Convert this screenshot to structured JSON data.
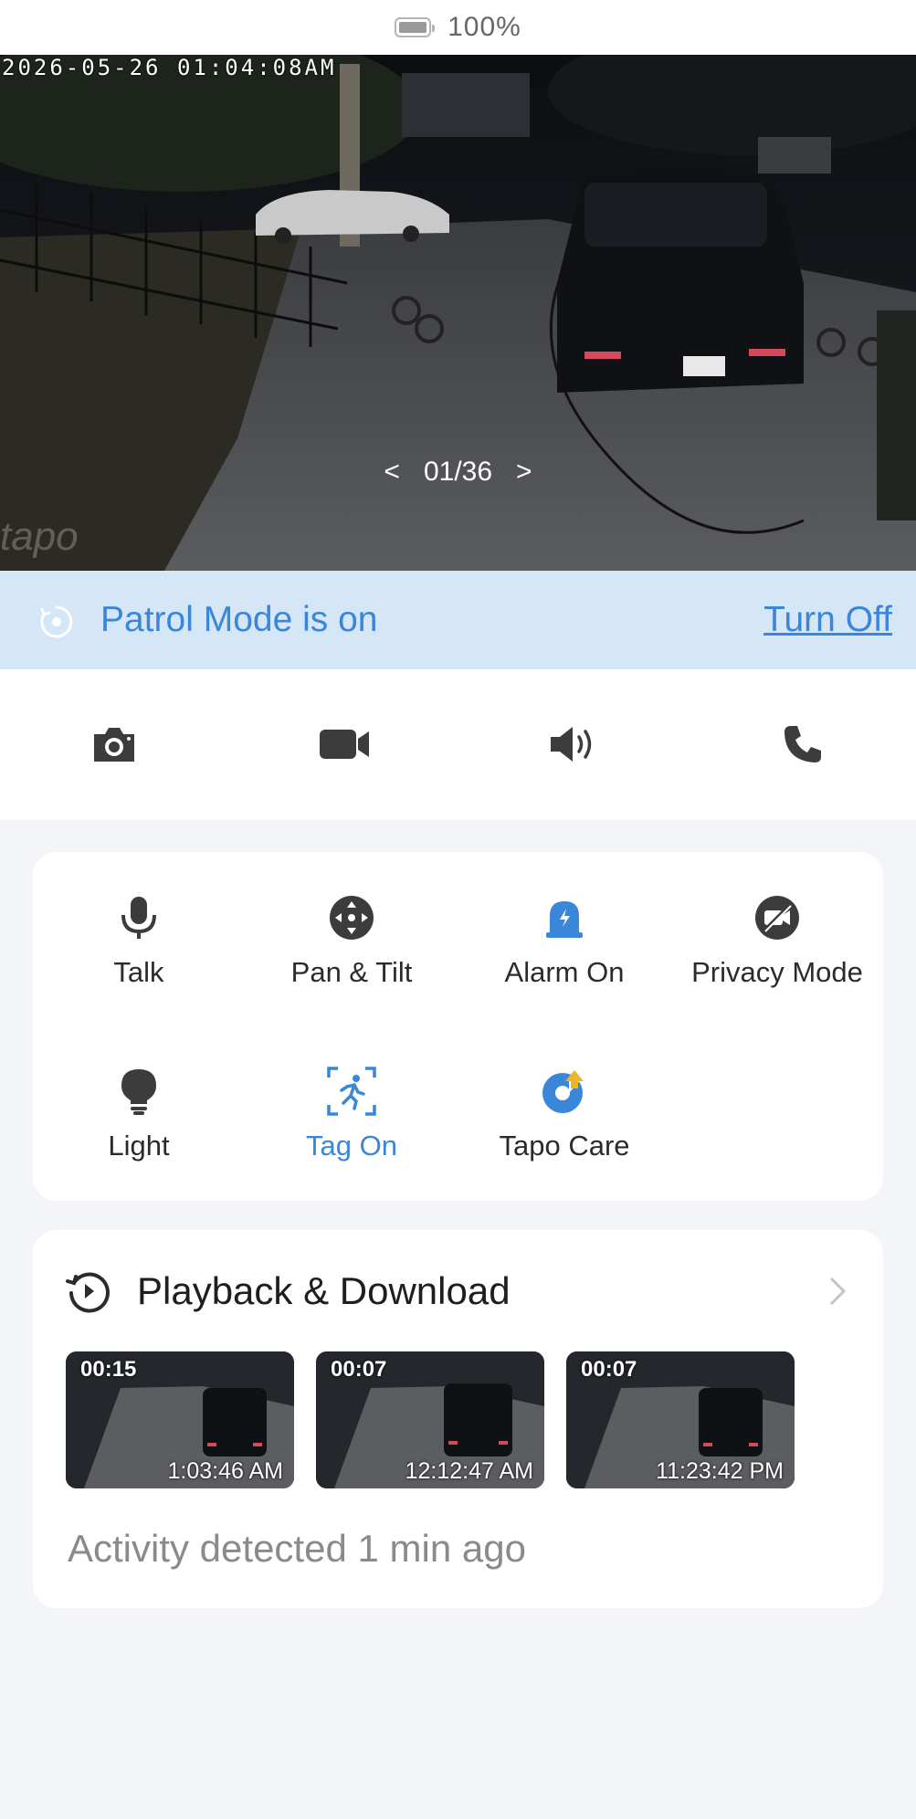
{
  "status": {
    "battery": "100%"
  },
  "video": {
    "timestamp": "2026-05-26  01:04:08AM",
    "watermark": "tapo",
    "pager": {
      "prev": "<",
      "position": "01/36",
      "next": ">"
    }
  },
  "patrol": {
    "text": "Patrol Mode is on",
    "action": "Turn Off"
  },
  "toolbar": {
    "items": [
      {
        "icon": "camera-icon"
      },
      {
        "icon": "video-camera-icon"
      },
      {
        "icon": "speaker-icon"
      },
      {
        "icon": "phone-icon"
      }
    ]
  },
  "features": {
    "items": [
      {
        "label": "Talk",
        "icon": "microphone-icon"
      },
      {
        "label": "Pan & Tilt",
        "icon": "pan-tilt-icon"
      },
      {
        "label": "Alarm On",
        "icon": "alarm-icon",
        "active": true
      },
      {
        "label": "Privacy Mode",
        "icon": "privacy-icon"
      },
      {
        "label": "Light",
        "icon": "lightbulb-icon"
      },
      {
        "label": "Tag On",
        "icon": "tag-person-icon",
        "active": true
      },
      {
        "label": "Tapo Care",
        "icon": "tapo-care-icon"
      }
    ]
  },
  "playback": {
    "title": "Playback & Download",
    "clips": [
      {
        "duration": "00:15",
        "time": "1:03:46 AM"
      },
      {
        "duration": "00:07",
        "time": "12:12:47 AM"
      },
      {
        "duration": "00:07",
        "time": "11:23:42 PM"
      }
    ],
    "activity": "Activity detected 1 min ago"
  },
  "colors": {
    "accent": "#3a86d8",
    "banner": "#d5e6f7",
    "background": "#f3f5f9"
  }
}
